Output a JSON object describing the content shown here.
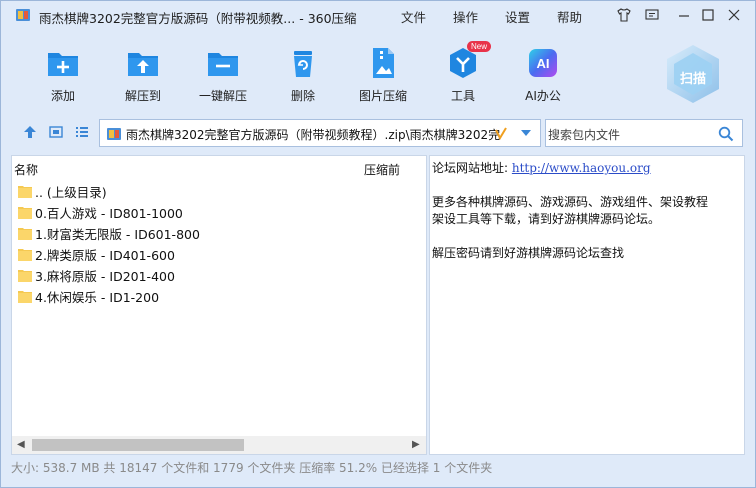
{
  "window": {
    "title": "雨杰棋牌3202完整官方版源码（附带视频教... - 360压缩",
    "menu": [
      "文件",
      "操作",
      "设置",
      "帮助"
    ],
    "accent": "#1f86e0",
    "background": "#dfeaf9"
  },
  "toolbar": {
    "items": [
      {
        "label": "添加",
        "icon": "add-folder-icon"
      },
      {
        "label": "解压到",
        "icon": "extract-to-icon"
      },
      {
        "label": "一键解压",
        "icon": "one-click-extract-icon"
      },
      {
        "label": "删除",
        "icon": "delete-icon"
      },
      {
        "label": "图片压缩",
        "icon": "image-compress-icon"
      },
      {
        "label": "工具",
        "icon": "tools-icon",
        "badge": "New"
      },
      {
        "label": "AI办公",
        "icon": "ai-office-icon",
        "glyph": "AI"
      }
    ],
    "scan_label": "扫描"
  },
  "address": {
    "path": "雨杰棋牌3202完整官方版源码（附带视频教程）.zip\\雨杰棋牌3202完",
    "search_placeholder": "搜索包内文件"
  },
  "file_list": {
    "columns": {
      "name": "名称",
      "compressed": "压缩前"
    },
    "rows": [
      {
        "name": ".. (上级目录)"
      },
      {
        "name": "0.百人游戏 - ID801-1000"
      },
      {
        "name": "1.财富类无限版 - ID601-800"
      },
      {
        "name": "2.牌类原版 - ID401-600"
      },
      {
        "name": "3.麻将原版 - ID201-400"
      },
      {
        "name": "4.休闲娱乐 - ID1-200"
      }
    ]
  },
  "comment": {
    "website_label": "论坛网站地址:",
    "website_url": "http://www.haoyou.org",
    "line2": "更多各种棋牌源码、游戏源码、游戏组件、架设教程",
    "line3": "架设工具等下载，请到好游棋牌源码论坛。",
    "line4": "解压密码请到好游棋牌源码论坛查找"
  },
  "status": {
    "text": "大小: 538.7 MB 共 18147 个文件和 1779 个文件夹 压缩率 51.2% 已经选择 1 个文件夹"
  }
}
